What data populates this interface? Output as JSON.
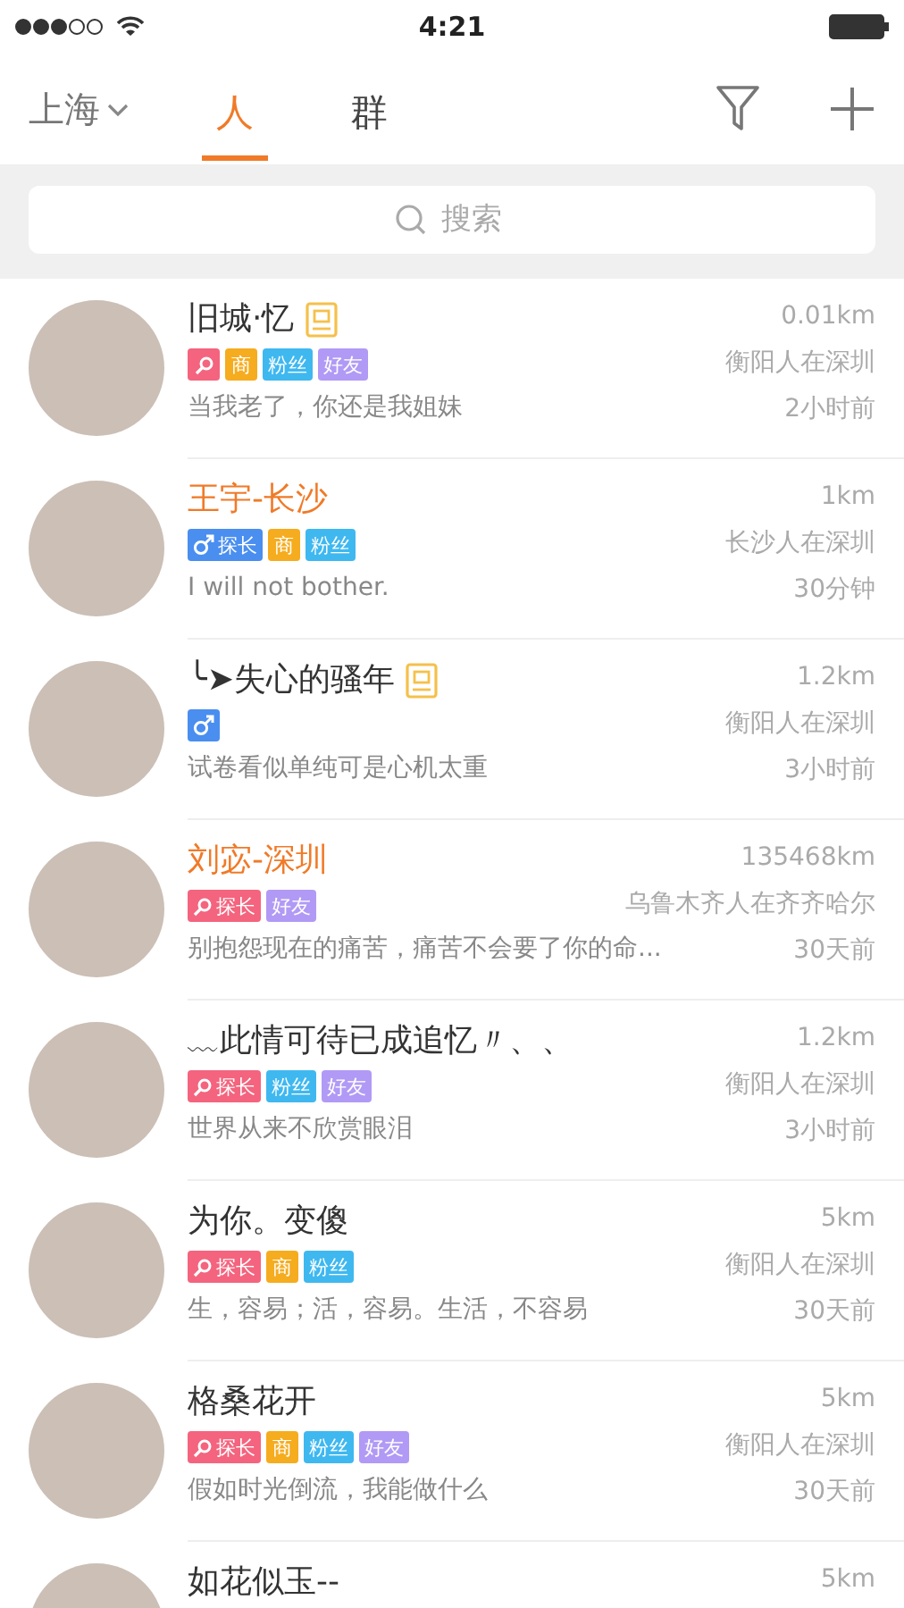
{
  "status_bar": {
    "time": "4:21"
  },
  "header": {
    "city": "上海",
    "tabs": [
      {
        "label": "人",
        "selected": true
      },
      {
        "label": "群",
        "selected": false
      }
    ]
  },
  "search": {
    "placeholder": "搜索"
  },
  "people": [
    {
      "name": "旧城·忆",
      "highlighted": false,
      "verified": true,
      "badges": [
        {
          "kind": "explorer"
        },
        {
          "kind": "shop",
          "label": "商"
        },
        {
          "kind": "fans",
          "label": "粉丝"
        },
        {
          "kind": "friend",
          "label": "好友"
        }
      ],
      "message": "当我老了，你还是我姐妹",
      "distance": "0.01km",
      "hometown": "衡阳人在深圳",
      "time": "2小时前"
    },
    {
      "name": "王宇-长沙",
      "highlighted": true,
      "verified": false,
      "badges": [
        {
          "kind": "male-explorer",
          "label": "探长"
        },
        {
          "kind": "shop",
          "label": "商"
        },
        {
          "kind": "fans",
          "label": "粉丝"
        }
      ],
      "message": "I will not bother.",
      "distance": "1km",
      "hometown": "长沙人在深圳",
      "time": "30分钟"
    },
    {
      "name": "╰➤失心的骚年",
      "highlighted": false,
      "verified": true,
      "badges": [
        {
          "kind": "male-explorer"
        }
      ],
      "message": "试卷看似单纯可是心机太重",
      "distance": "1.2km",
      "hometown": "衡阳人在深圳",
      "time": "3小时前"
    },
    {
      "name": "刘宓-深圳",
      "highlighted": true,
      "verified": false,
      "badges": [
        {
          "kind": "explorer",
          "label": "探长"
        },
        {
          "kind": "friend",
          "label": "好友"
        }
      ],
      "message": "别抱怨现在的痛苦，痛苦不会要了你的命...",
      "distance": "135468km",
      "hometown": "乌鲁木齐人在齐齐哈尔",
      "time": "30天前"
    },
    {
      "name": "﹏此情可待已成追忆〃、、",
      "highlighted": false,
      "verified": false,
      "badges": [
        {
          "kind": "explorer",
          "label": "探长"
        },
        {
          "kind": "fans",
          "label": "粉丝"
        },
        {
          "kind": "friend",
          "label": "好友"
        }
      ],
      "message": "世界从来不欣赏眼泪",
      "distance": "1.2km",
      "hometown": "衡阳人在深圳",
      "time": "3小时前"
    },
    {
      "name": "为你。变傻",
      "highlighted": false,
      "verified": false,
      "badges": [
        {
          "kind": "explorer",
          "label": "探长"
        },
        {
          "kind": "shop",
          "label": "商"
        },
        {
          "kind": "fans",
          "label": "粉丝"
        }
      ],
      "message": "生，容易；活，容易。生活，不容易",
      "distance": "5km",
      "hometown": "衡阳人在深圳",
      "time": "30天前"
    },
    {
      "name": "格桑花开",
      "highlighted": false,
      "verified": false,
      "badges": [
        {
          "kind": "explorer",
          "label": "探长"
        },
        {
          "kind": "shop",
          "label": "商"
        },
        {
          "kind": "fans",
          "label": "粉丝"
        },
        {
          "kind": "friend",
          "label": "好友"
        }
      ],
      "message": "假如时光倒流，我能做什么",
      "distance": "5km",
      "hometown": "衡阳人在深圳",
      "time": "30天前"
    },
    {
      "name": "如花似玉--",
      "highlighted": false,
      "verified": false,
      "distance": "5km"
    }
  ]
}
